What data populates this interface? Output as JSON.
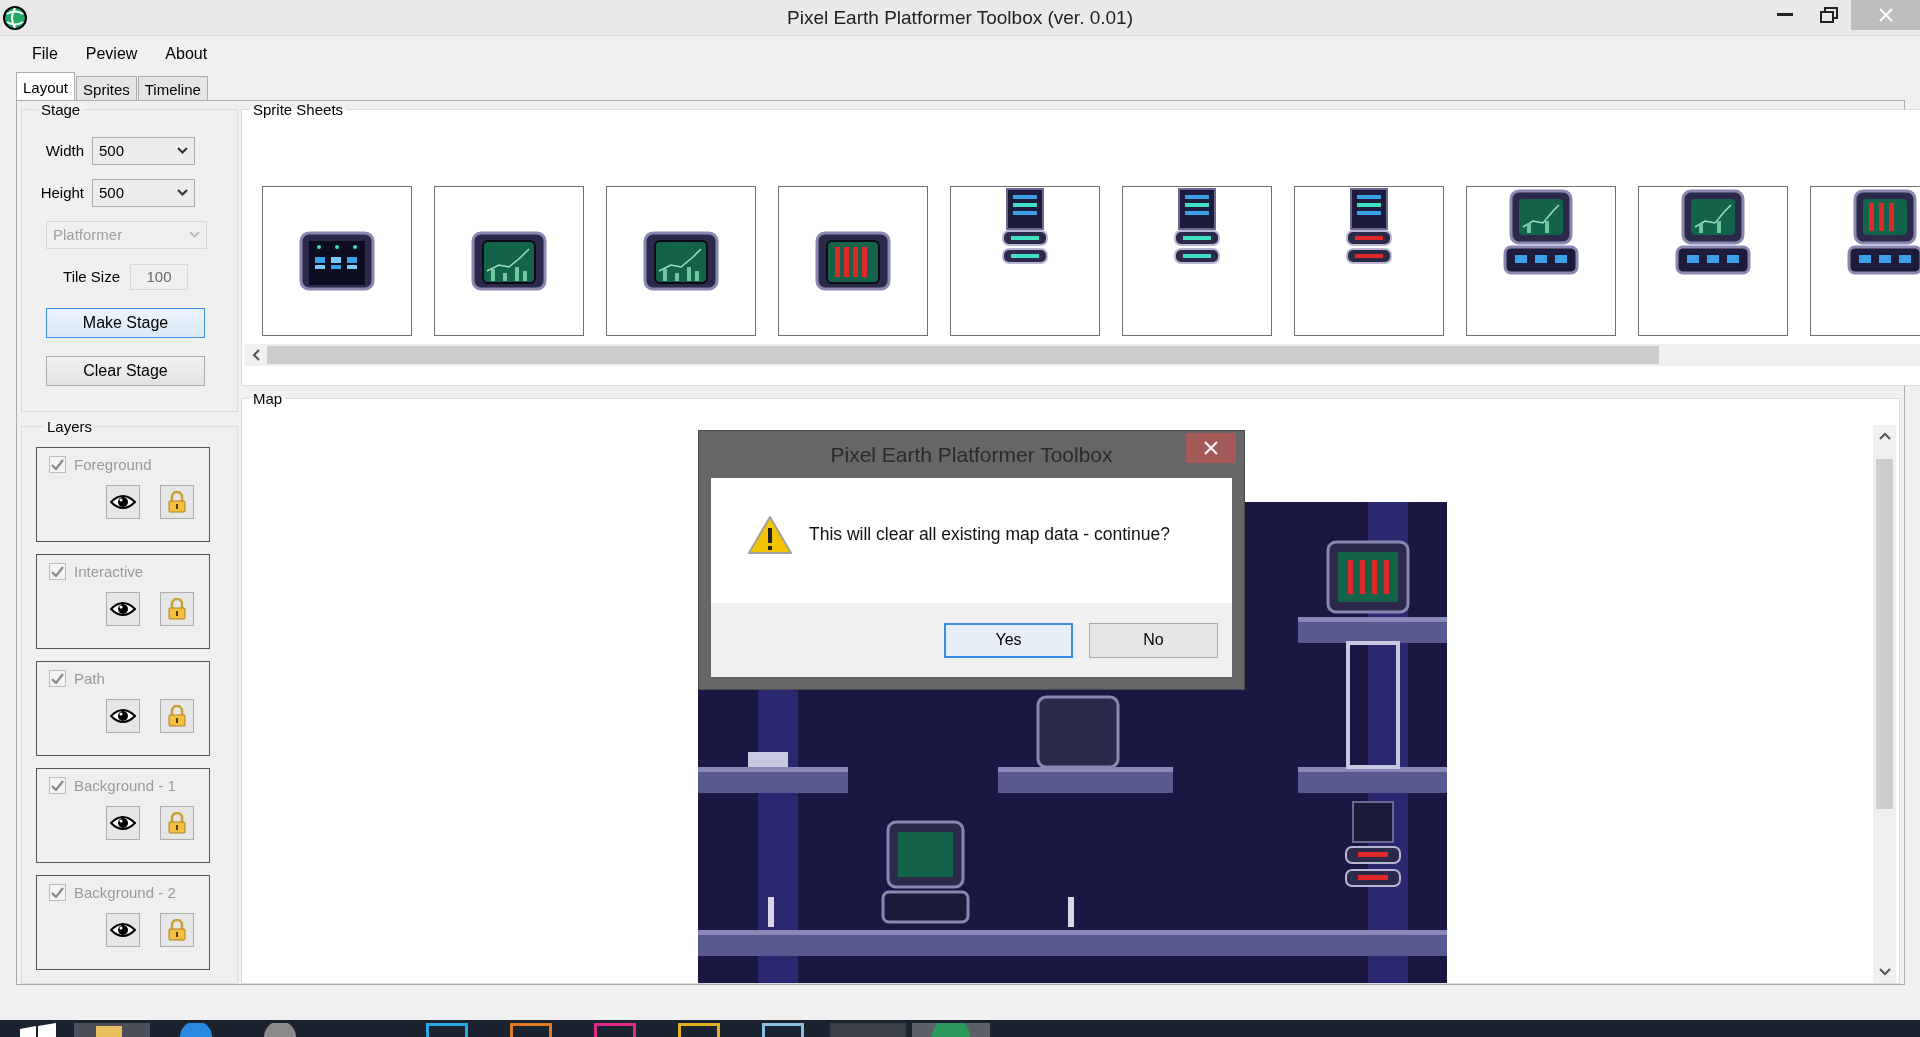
{
  "window": {
    "title": "Pixel Earth Platformer Toolbox (ver. 0.01)"
  },
  "menu": [
    "File",
    "Peview",
    "About"
  ],
  "tabs": [
    {
      "label": "Layout",
      "selected": true
    },
    {
      "label": "Sprites",
      "selected": false
    },
    {
      "label": "Timeline",
      "selected": false
    }
  ],
  "stage": {
    "title": "Stage",
    "width": {
      "label": "Width",
      "value": "500"
    },
    "height": {
      "label": "Height",
      "value": "500"
    },
    "mode": {
      "value": "Platformer",
      "disabled": true
    },
    "tile_size": {
      "label": "Tile Size",
      "value": "100",
      "disabled": true
    },
    "buttons": [
      {
        "label": "Make Stage",
        "focused": true
      },
      {
        "label": "Clear Stage",
        "focused": false
      }
    ]
  },
  "layers": {
    "title": "Layers",
    "items": [
      {
        "name": "Foreground",
        "checked": true,
        "disabled": true
      },
      {
        "name": "Interactive",
        "checked": true,
        "disabled": true
      },
      {
        "name": "Path",
        "checked": true,
        "disabled": true
      },
      {
        "name": "Background - 1",
        "checked": true,
        "disabled": true
      },
      {
        "name": "Background - 2",
        "checked": true,
        "disabled": true
      }
    ]
  },
  "sprite_sheets": {
    "title": "Sprite Sheets",
    "items": [
      {
        "kind": "server"
      },
      {
        "kind": "monitor"
      },
      {
        "kind": "monitor"
      },
      {
        "kind": "alarm"
      },
      {
        "kind": "tower"
      },
      {
        "kind": "tower"
      },
      {
        "kind": "alarm-tower"
      },
      {
        "kind": "terminal"
      },
      {
        "kind": "terminal"
      },
      {
        "kind": "alarm-terminal"
      }
    ]
  },
  "map": {
    "title": "Map"
  },
  "dialog": {
    "title": "Pixel Earth Platformer Toolbox",
    "message": "This will clear all existing map data - continue?",
    "buttons": [
      {
        "label": "Yes",
        "focused": true
      },
      {
        "label": "No",
        "focused": false
      }
    ]
  }
}
